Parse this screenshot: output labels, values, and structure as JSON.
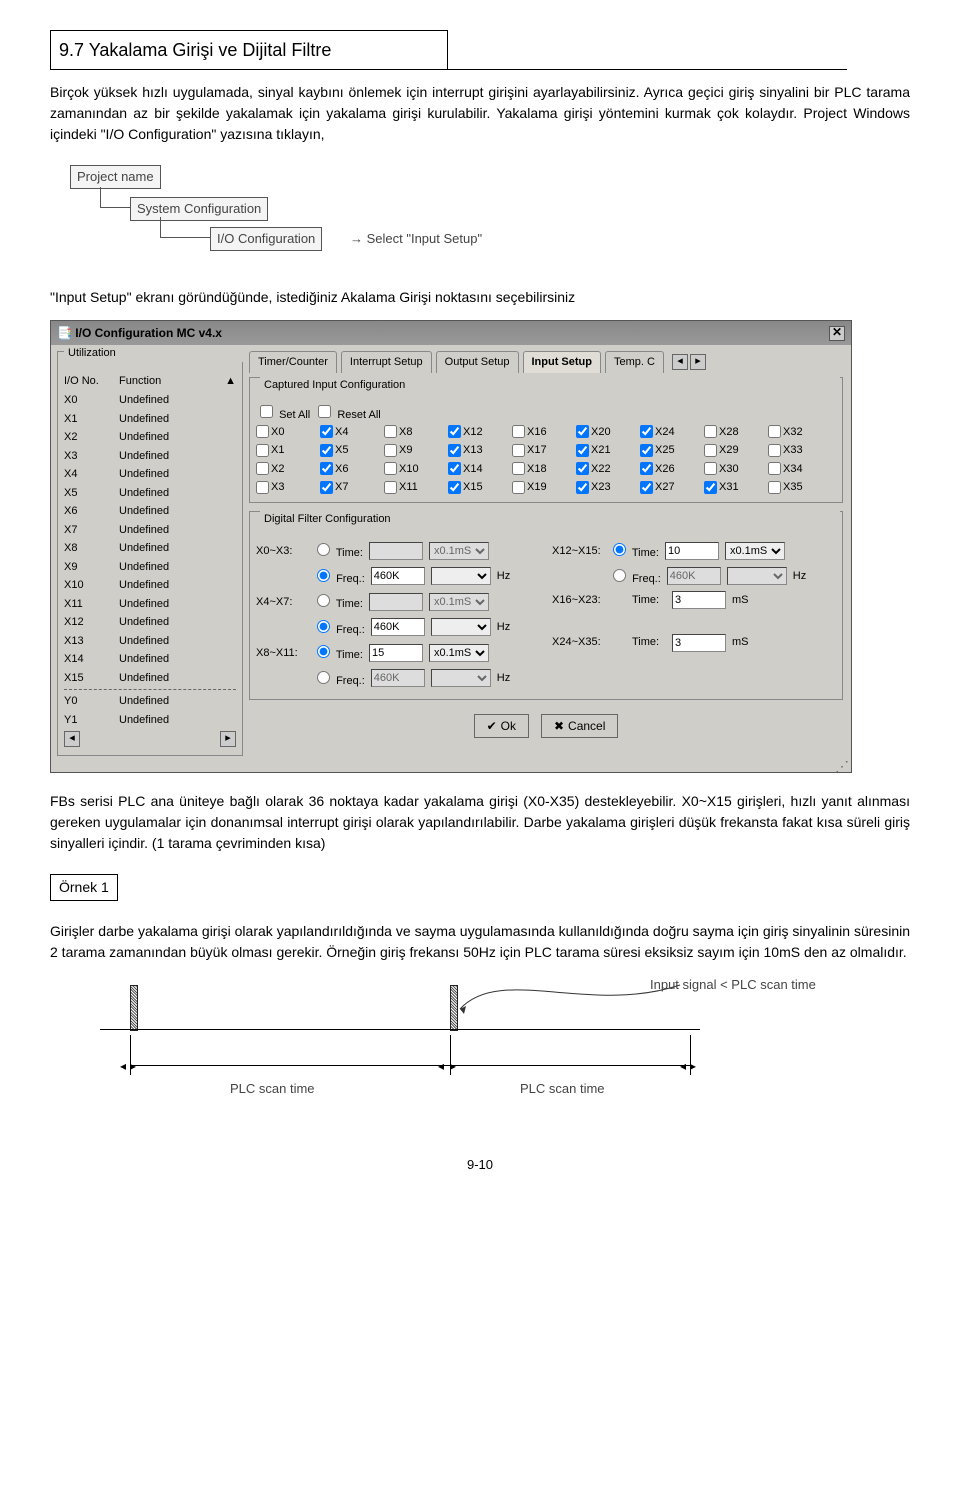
{
  "section_title": "9.7 Yakalama Girişi ve Dijital Filtre",
  "para1": "Birçok yüksek hızlı uygulamada, sinyal kaybını önlemek için interrupt girişini ayarlayabilirsiniz. Ayrıca geçici giriş sinyalini bir PLC tarama zamanından az bir şekilde yakalamak için yakalama girişi kurulabilir. Yakalama girişi yöntemini kurmak çok kolaydır. Project Windows içindeki \"I/O Configuration\" yazısına tıklayın,",
  "tree": {
    "l1": "Project name",
    "l2": "System Configuration",
    "l3": "I/O Configuration",
    "suffix": "→ Select   \"Input Setup\""
  },
  "para2": "\"Input Setup\" ekranı göründüğünde, istediğiniz Akalama Girişi noktasını seçebilirsiniz",
  "dialog": {
    "title": "I/O Configuration MC v4.x",
    "util_label": "Utilization",
    "head_no": "I/O No.",
    "head_fn": "Function",
    "x_rows": [
      "X0",
      "X1",
      "X2",
      "X3",
      "X4",
      "X5",
      "X6",
      "X7",
      "X8",
      "X9",
      "X10",
      "X11",
      "X12",
      "X13",
      "X14",
      "X15"
    ],
    "y_rows": [
      "Y0",
      "Y1"
    ],
    "undef": "Undefined",
    "tabs": [
      "Timer/Counter",
      "Interrupt Setup",
      "Output Setup",
      "Input Setup",
      "Temp. C"
    ],
    "grp_captured": "Captured Input Configuration",
    "set_all": "Set All",
    "reset_all": "Reset All",
    "grp_digital": "Digital Filter Configuration",
    "freq_label": "Freq.:",
    "time_label": "Time:",
    "df": {
      "r1": {
        "range": "X0~X3:",
        "time": "",
        "time_unit": "x0.1mS",
        "freq": "460K"
      },
      "r2": {
        "range": "X4~X7:",
        "time": "",
        "time_unit": "x0.1mS",
        "freq": "460K"
      },
      "r3": {
        "range": "X8~X11:",
        "time": "15",
        "time_unit": "x0.1mS",
        "freq": "460K"
      },
      "r4": {
        "range": "X12~X15:",
        "time": "10",
        "time_unit": "x0.1mS",
        "freq": "460K"
      },
      "r5": {
        "range": "X16~X23:",
        "time": "3",
        "unit": "mS"
      },
      "r6": {
        "range": "X24~X35:",
        "time": "3",
        "unit": "mS"
      }
    },
    "hz": "Hz",
    "ok": "Ok",
    "cancel": "Cancel"
  },
  "para3": "FBs serisi PLC ana üniteye bağlı olarak 36 noktaya kadar yakalama girişi (X0-X35) destekleyebilir. X0~X15 girişleri, hızlı yanıt alınması gereken uygulamalar için donanımsal interrupt girişi olarak yapılandırılabilir. Darbe yakalama girişleri düşük frekansta fakat kısa süreli giriş sinyalleri içindir. (1 tarama çevriminden kısa)",
  "ornek": "Örnek 1",
  "para4": "Girişler darbe yakalama girişi olarak yapılandırıldığında ve sayma uygulamasında kullanıldığında doğru sayma için giriş sinyalinin süresinin 2 tarama zamanından büyük olması gerekir. Örneğin giriş frekansı 50Hz için PLC tarama süresi eksiksiz sayım için 10mS den az olmalıdır.",
  "timing": {
    "input_signal": "Input signal < PLC scan time",
    "scan1": "PLC scan time",
    "scan2": "PLC scan time"
  },
  "page": "9-10"
}
